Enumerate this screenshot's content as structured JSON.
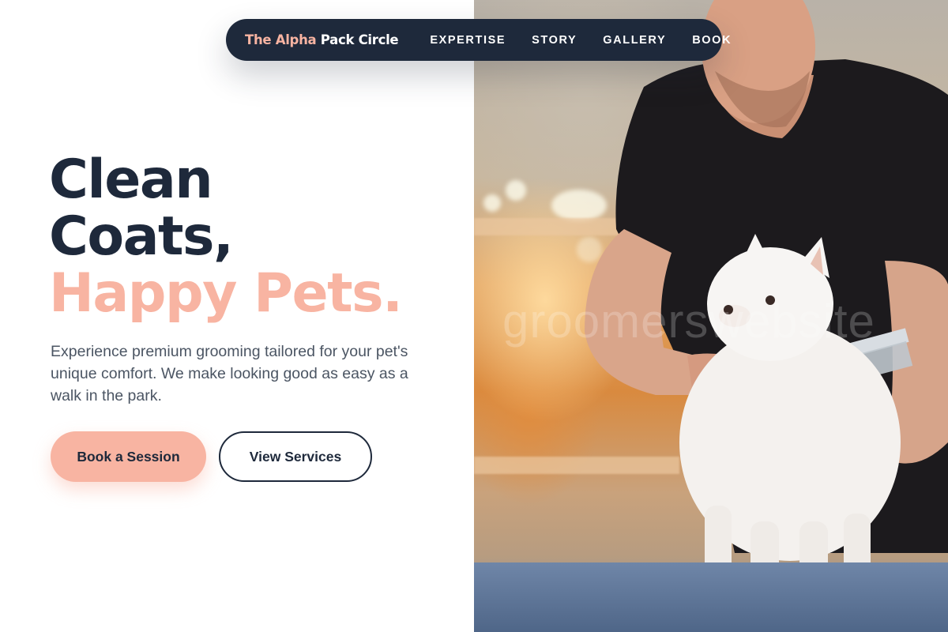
{
  "nav": {
    "brand_accent": "The Alpha",
    "brand_rest": " Pack Circle",
    "links": [
      {
        "label": "EXPERTISE"
      },
      {
        "label": "STORY"
      },
      {
        "label": "GALLERY"
      },
      {
        "label": "BOOK"
      }
    ]
  },
  "hero": {
    "title_line1": "Clean",
    "title_line2": "Coats,",
    "title_line3": "Happy Pets.",
    "description": "Experience premium grooming tailored for your pet's unique comfort. We make looking good as easy as a walk in the park.",
    "primary_button": "Book a Session",
    "secondary_button": "View Services"
  },
  "image": {
    "alt": "Groomer combing a white Pomeranian dog on a grooming table",
    "watermark": "groomerswebsite"
  },
  "colors": {
    "navy": "#1e293b",
    "accent": "#f8b4a2",
    "text_muted": "#4b5563"
  }
}
